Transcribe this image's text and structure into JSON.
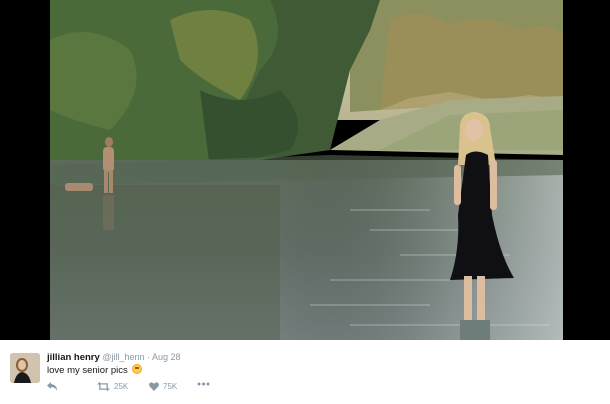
{
  "tweet": {
    "display_name": "jillian henry",
    "handle": "@jill_henn",
    "separator": "·",
    "date": "Aug 28",
    "text": "love my senior pics",
    "emoji": "smiling-face-with-blush-emoji",
    "retweet_count": "25K",
    "like_count": "75K"
  },
  "icons": {
    "reply": "reply-icon",
    "retweet": "retweet-icon",
    "like": "heart-icon",
    "more": "more-options-icon"
  },
  "colors": {
    "text": "#14171a",
    "secondary": "#8899a6",
    "media_background": "#000000"
  }
}
